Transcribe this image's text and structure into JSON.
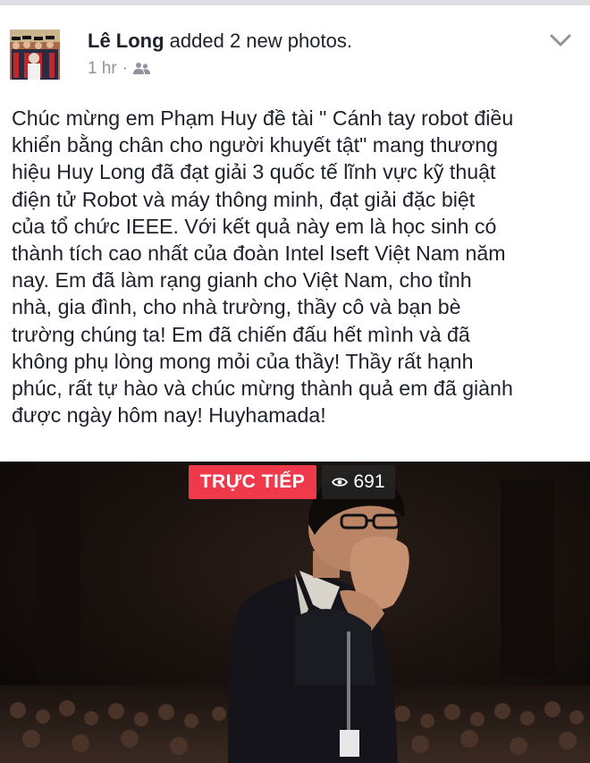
{
  "post": {
    "author": "Lê Long",
    "action": "added 2 new photos.",
    "time": "1 hr",
    "separator": "·",
    "privacy_icon": "friends-icon",
    "menu_icon": "chevron-down-icon",
    "text": "Chúc mừng em Phạm Huy đề tài \" Cánh tay robot điều\nkhiển bằng chân cho người khuyết tật\" mang thương\nhiệu Huy Long đã đạt giải 3 quốc tế lĩnh vực kỹ thuật\nđiện tử Robot và máy thông minh, đạt giải đặc biệt\ncủa tổ chức IEEE. Với kết quả này em là học sinh có\nthành tích cao nhất của đoàn Intel Iseft Việt Nam năm\nnay.  Em đã làm rạng gianh cho Việt Nam, cho tỉnh\nnhà, gia đình, cho nhà trường, thầy cô và bạn bè\ntrường chúng ta! Em đã chiến đấu hết mình và đã\nkhông phụ lòng mong mỏi của thầy! Thầy rất hạnh\nphúc, rất tự hào và chúc mừng thành quả em đã giành\nđược ngày hôm nay! Huyhamada!"
  },
  "media": {
    "live_label": "TRỰC TIẾP",
    "viewer_icon": "eye-icon",
    "viewer_count": "691"
  },
  "colors": {
    "live_red": "#f0394a",
    "meta_gray": "#90949c",
    "text": "#1d2129"
  }
}
